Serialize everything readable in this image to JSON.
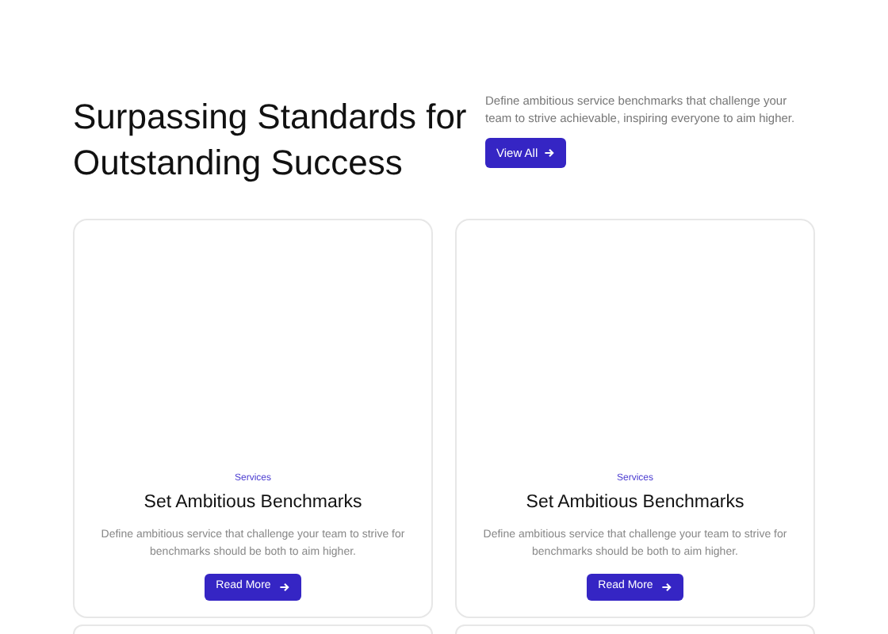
{
  "heading": "Surpassing Standards for Outstanding Success",
  "intro": "Define ambitious service benchmarks that challenge your team to strive achievable, inspiring everyone to aim higher.",
  "view_all": "View All",
  "cards": [
    {
      "tag": "Services",
      "title": "Set Ambitious Benchmarks",
      "text": "Define ambitious service that challenge your team to strive for benchmarks should be both  to aim higher.",
      "button": "Read More"
    },
    {
      "tag": "Services",
      "title": "Set Ambitious Benchmarks",
      "text": "Define ambitious service that challenge your team to strive for benchmarks should be both  to aim higher.",
      "button": "Read More"
    }
  ]
}
